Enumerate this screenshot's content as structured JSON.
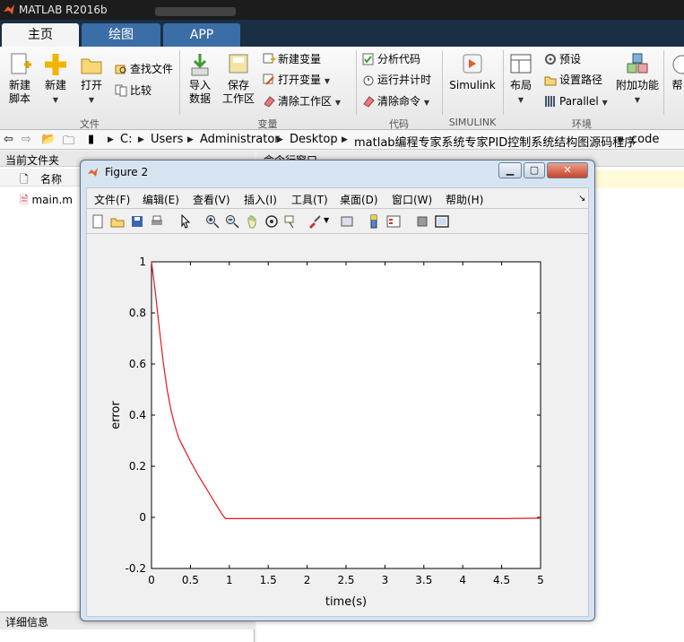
{
  "app": {
    "title": "MATLAB R2016b"
  },
  "tabs": [
    {
      "label": "主页"
    },
    {
      "label": "绘图"
    },
    {
      "label": "APP"
    }
  ],
  "ribbon": {
    "file": {
      "new_script": "新建\n脚本",
      "new": "新建",
      "open": "打开",
      "find_files": "查找文件",
      "compare": "比较",
      "group": "文件"
    },
    "variable": {
      "import": "导入\n数据",
      "save_ws": "保存\n工作区",
      "new_var": "新建变量",
      "open_var": "打开变量",
      "clear_ws": "清除工作区",
      "group": "变量"
    },
    "code": {
      "analyze": "分析代码",
      "run_timing": "运行并计时",
      "clear_cmd": "清除命令",
      "group": "代码"
    },
    "simulink": {
      "label": "Simulink",
      "group": "SIMULINK"
    },
    "env": {
      "layout": "布局",
      "prefs": "预设",
      "set_path": "设置路径",
      "parallel": "Parallel",
      "addons": "附加功能",
      "help": "帮",
      "group": "环境"
    }
  },
  "address": {
    "crumbs": [
      "C:",
      "Users",
      "Administrator",
      "Desktop",
      "matlab编程专家系统专家PID控制系统结构图源码程序",
      "code"
    ]
  },
  "left_panel": {
    "title": "当前文件夹",
    "col_name": "名称",
    "files": [
      "main.m"
    ],
    "details": "详细信息"
  },
  "right_panel": {
    "title": "命令行窗口"
  },
  "figure": {
    "title": "Figure 2",
    "menus": [
      "文件(F)",
      "编辑(E)",
      "查看(V)",
      "插入(I)",
      "工具(T)",
      "桌面(D)",
      "窗口(W)",
      "帮助(H)"
    ],
    "chart_data": {
      "type": "line",
      "title": "",
      "xlabel": "time(s)",
      "ylabel": "error",
      "xlim": [
        0,
        5
      ],
      "ylim": [
        -0.2,
        1
      ],
      "xticks": [
        0,
        0.5,
        1,
        1.5,
        2,
        2.5,
        3,
        3.5,
        4,
        4.5,
        5
      ],
      "yticks": [
        -0.2,
        0,
        0.2,
        0.4,
        0.6,
        0.8,
        1
      ],
      "xtick_labels": [
        "0",
        "0.5",
        "1",
        "1.5",
        "2",
        "2.5",
        "3",
        "3.5",
        "4",
        "4.5",
        "5"
      ],
      "ytick_labels": [
        "-0.2",
        "0",
        "0.2",
        "0.4",
        "0.6",
        "0.8",
        "1"
      ],
      "grid": false,
      "series": [
        {
          "color": "#e8141b",
          "x": [
            0,
            0.05,
            0.1,
            0.15,
            0.2,
            0.25,
            0.3,
            0.35,
            0.4,
            0.5,
            0.6,
            0.7,
            0.8,
            0.85,
            0.9,
            0.95,
            1.0,
            1.5,
            2,
            2.5,
            3,
            3.5,
            4,
            4.5,
            5
          ],
          "y": [
            1.0,
            0.88,
            0.74,
            0.61,
            0.5,
            0.42,
            0.36,
            0.31,
            0.28,
            0.22,
            0.165,
            0.115,
            0.065,
            0.04,
            0.015,
            -0.005,
            -0.005,
            -0.005,
            -0.005,
            -0.005,
            -0.005,
            -0.005,
            -0.005,
            -0.005,
            -0.003
          ]
        }
      ]
    }
  }
}
